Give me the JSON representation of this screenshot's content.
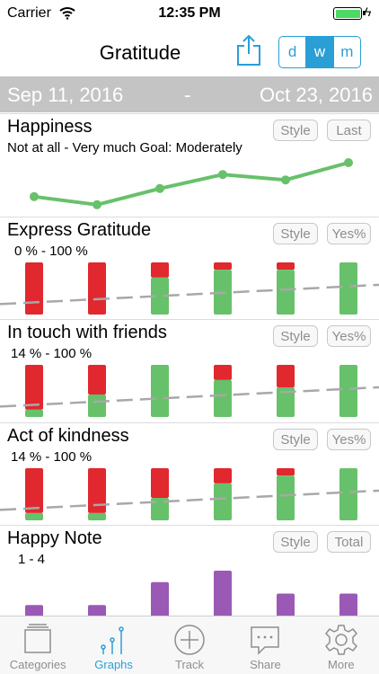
{
  "status": {
    "carrier": "Carrier",
    "time": "12:35 PM",
    "battery_level": 1.0
  },
  "nav": {
    "title": "Gratitude",
    "segments": [
      "d",
      "w",
      "m"
    ],
    "active_segment": 1
  },
  "date_range": {
    "start": "Sep 11, 2016",
    "separator": "-",
    "end": "Oct 23, 2016"
  },
  "sections": [
    {
      "title": "Happiness",
      "subtitle": "Not at all - Very much Goal: Moderately",
      "style_label": "Style",
      "mode_label": "Last"
    },
    {
      "title": "Express Gratitude",
      "subtitle": "0 % - 100 %",
      "style_label": "Style",
      "mode_label": "Yes%"
    },
    {
      "title": "In touch with friends",
      "subtitle": "14 % - 100 %",
      "style_label": "Style",
      "mode_label": "Yes%"
    },
    {
      "title": "Act of kindness",
      "subtitle": "14 % - 100 %",
      "style_label": "Style",
      "mode_label": "Yes%"
    },
    {
      "title": "Happy Note",
      "subtitle": "1 - 4",
      "style_label": "Style",
      "mode_label": "Total"
    }
  ],
  "tabs": [
    {
      "label": "Categories",
      "icon": "categories-icon"
    },
    {
      "label": "Graphs",
      "icon": "graphs-icon"
    },
    {
      "label": "Track",
      "icon": "plus-circle-icon"
    },
    {
      "label": "Share",
      "icon": "chat-bubble-icon"
    },
    {
      "label": "More",
      "icon": "gear-icon"
    }
  ],
  "colors": {
    "accent": "#2a9fd6",
    "yes": "#67c16a",
    "no": "#e0282e",
    "line": "#67c16a",
    "trend": "#a8a8a8",
    "purple": "#9b59b6"
  },
  "chart_data": [
    {
      "type": "line",
      "series": [
        {
          "values": [
            0.22,
            0.07,
            0.37,
            0.63,
            0.53,
            0.85
          ]
        }
      ],
      "ylim": [
        0,
        1
      ]
    },
    {
      "type": "bar",
      "series": [
        {
          "values": [
            0,
            0,
            0.71,
            0.86,
            0.86,
            1.0
          ]
        }
      ],
      "ylim": [
        0,
        1
      ],
      "trend": [
        0.2,
        0.57
      ]
    },
    {
      "type": "bar",
      "series": [
        {
          "values": [
            0.14,
            0.43,
            1.0,
            0.71,
            0.57,
            1.0
          ]
        }
      ],
      "ylim": [
        0,
        1
      ],
      "trend": [
        0.2,
        0.57
      ]
    },
    {
      "type": "bar",
      "series": [
        {
          "values": [
            0.14,
            0.14,
            0.43,
            0.71,
            0.86,
            1.0
          ]
        }
      ],
      "ylim": [
        0,
        1
      ],
      "trend": [
        0.2,
        0.57
      ]
    },
    {
      "type": "bar",
      "series": [
        {
          "values": [
            1,
            1,
            3,
            4,
            2,
            2
          ]
        }
      ],
      "ylim": [
        0,
        4
      ]
    }
  ]
}
